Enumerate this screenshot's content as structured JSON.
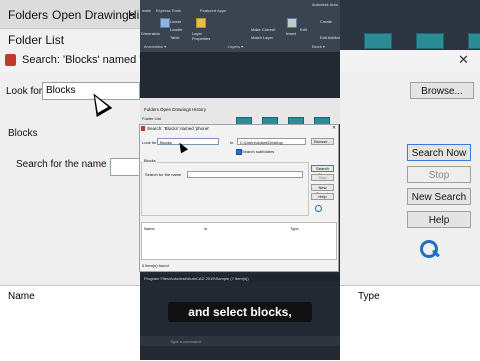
{
  "background": {
    "tabs": [
      "Folders",
      "Open Drawings",
      "His"
    ],
    "folder_list_label": "Folder List",
    "search_title": "Search: 'Blocks' named 'ph",
    "look_for_label": "Look for",
    "look_for_value": "Blocks",
    "blocks_label": "Blocks",
    "search_for_name_label": "Search for the name",
    "buttons": {
      "browse": "Browse...",
      "search_now": "Search Now",
      "stop": "Stop",
      "new_search": "New Search",
      "help": "Help"
    },
    "results_columns": {
      "name": "Name",
      "type": "Type"
    },
    "close_glyph": "✕"
  },
  "screen": {
    "ribbon_tabs": [
      "mate",
      "Express Tools",
      "Featured Apps"
    ],
    "app_title": "Autodesk Auto",
    "ribbon_items": [
      "Linear",
      "Leader",
      "Table",
      "Dimension",
      "Layer Properties",
      "Make Current",
      "Match Layer",
      "Insert",
      "Edit",
      "Create",
      "Edit Attributes"
    ],
    "ribbon_groups": [
      "Annotation ▾",
      "Layers ▾",
      "Block ▾"
    ],
    "dc_tabs": [
      "Folders",
      "Open Drawings",
      "History"
    ],
    "dc_folder_list": "Folder List",
    "dialog": {
      "title": "Search: 'Blocks' named 'phone'",
      "look_for_label": "Look for",
      "look_for_value": "Blocks",
      "in_label": "In",
      "in_value": "C:\\Users\\Adam\\Desktop",
      "browse": "Browse...",
      "search_subfolders": "Search subfolders",
      "group_label": "Blocks",
      "search_name_label": "Search for the name",
      "search_now": "Search Now",
      "stop": "Stop",
      "new_search": "New Search",
      "help": "Help",
      "col_name": "Name",
      "col_in": "In",
      "col_type": "Type",
      "status": "0 item(s) found"
    },
    "path_bar": "Program Files\\Autodesk\\AutoCAD 2019\\Sample (7 Item(s))",
    "command_prompt": "Type a command"
  },
  "caption": "and select blocks,",
  "colors": {
    "accent_teal": "#2b8c96",
    "caption_bg": "#111111"
  }
}
